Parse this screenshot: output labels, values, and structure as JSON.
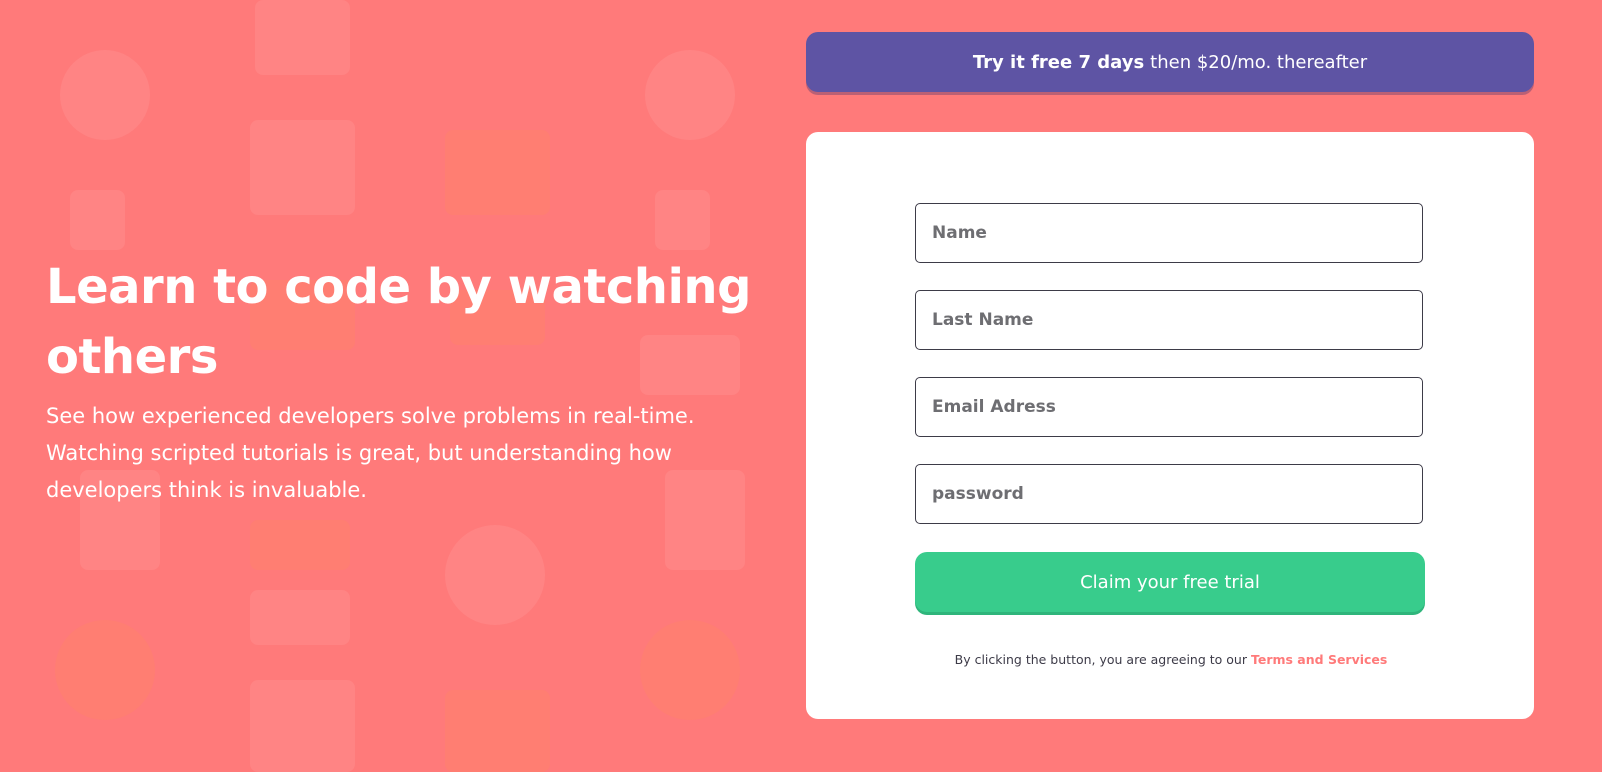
{
  "hero": {
    "title": "Learn to code by watching others",
    "description": "See how experienced developers solve problems in real-time. Watching scripted tutorials is great, but understanding how developers think is invaluable."
  },
  "banner": {
    "bold": "Try it free 7 days",
    "rest": "then $20/mo. thereafter"
  },
  "form": {
    "first_name_placeholder": "Name",
    "last_name_placeholder": "Last Name",
    "email_placeholder": "Email Adress",
    "password_placeholder": "password",
    "submit_label": "Claim your free trial",
    "terms_text": "By clicking the button, you are agreeing to our",
    "terms_link": "Terms and Services"
  },
  "colors": {
    "background": "#ff7a7a",
    "banner": "#5e54a4",
    "button": "#38cc8c",
    "text_dark": "#3d3b48"
  }
}
